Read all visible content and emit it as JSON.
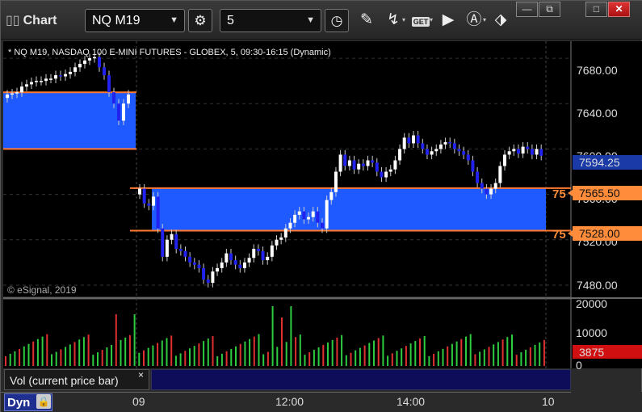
{
  "window": {
    "app_title": "Chart",
    "symbol": "NQ M19",
    "interval": "5",
    "controls": {
      "minimize": "—",
      "restore": "⧉",
      "maximize": "□",
      "close": "✕"
    }
  },
  "toolbar": {
    "icons": [
      "settings-gear-icon",
      "clock-icon",
      "pencil-icon",
      "study-icon",
      "get-icon",
      "play-icon",
      "alert-icon",
      "link-icon"
    ],
    "get_label": "GET"
  },
  "chart": {
    "header": "* NQ M19, NASDAQ 100 E-MINI FUTURES - GLOBEX, 5, 09:30-16:15 (Dynamic)",
    "copyright": "© eSignal, 2019",
    "price_ticks": [
      "7680.00",
      "7640.00",
      "7600.00",
      "7560.00",
      "7520.00",
      "7480.00"
    ],
    "last_price_label": "7594.25",
    "upper_zone_label": "7565.50",
    "lower_zone_label": "7528.00",
    "zone_marker_text": "75",
    "volume_ticks": [
      "20000",
      "10000",
      "0"
    ],
    "volume_last_label": "3875",
    "colors": {
      "up": "#ffffff",
      "down": "#2222ee",
      "zone": "#1e5aff",
      "zone_line": "#ff7a30",
      "vol_up": "#2ecc40",
      "vol_down": "#e03030",
      "last_price": "#1a3aa8",
      "vol_last": "#d01010"
    }
  },
  "chart_data": {
    "type": "candlestick",
    "price_axis": {
      "ylim": [
        7470,
        7695
      ],
      "ticks": [
        7680,
        7640,
        7600,
        7560,
        7520,
        7480
      ]
    },
    "zones": [
      {
        "top": 7650,
        "bottom": 7600,
        "session": "previous"
      },
      {
        "top": 7565.5,
        "bottom": 7528,
        "session": "current"
      }
    ],
    "last_price": 7594.25,
    "previous_session_closes": [
      7648,
      7649,
      7650,
      7655,
      7657,
      7659,
      7660,
      7660,
      7662,
      7662,
      7665,
      7664,
      7666,
      7668,
      7672,
      7675,
      7678,
      7680,
      7681,
      7672,
      7665,
      7650,
      7640,
      7625,
      7640,
      7648
    ],
    "current_session_closes": [
      7565,
      7552,
      7550,
      7558,
      7530,
      7505,
      7520,
      7525,
      7512,
      7510,
      7505,
      7500,
      7498,
      7495,
      7485,
      7482,
      7492,
      7495,
      7500,
      7508,
      7502,
      7498,
      7495,
      7500,
      7504,
      7512,
      7510,
      7502,
      7505,
      7515,
      7520,
      7522,
      7530,
      7535,
      7542,
      7545,
      7538,
      7540,
      7545,
      7535,
      7530,
      7555,
      7562,
      7580,
      7595,
      7585,
      7590,
      7582,
      7587,
      7585,
      7590,
      7588,
      7580,
      7575,
      7580,
      7582,
      7590,
      7600,
      7610,
      7605,
      7612,
      7605,
      7600,
      7595,
      7598,
      7600,
      7604,
      7606,
      7605,
      7600,
      7598,
      7595,
      7590,
      7580,
      7570,
      7565,
      7560,
      7565,
      7570,
      7585,
      7595,
      7598,
      7600,
      7596,
      7602,
      7600,
      7595,
      7600,
      7594
    ],
    "volume_axis": {
      "ylim": [
        0,
        20000
      ],
      "ticks": [
        20000,
        10000,
        0
      ]
    },
    "volume_last": 3875,
    "time_labels": [
      "09",
      "12:00",
      "14:00",
      "10"
    ]
  },
  "footer": {
    "vol_legend": "Vol (current price bar)",
    "vol_close": "×",
    "dyn_label": "Dyn"
  }
}
